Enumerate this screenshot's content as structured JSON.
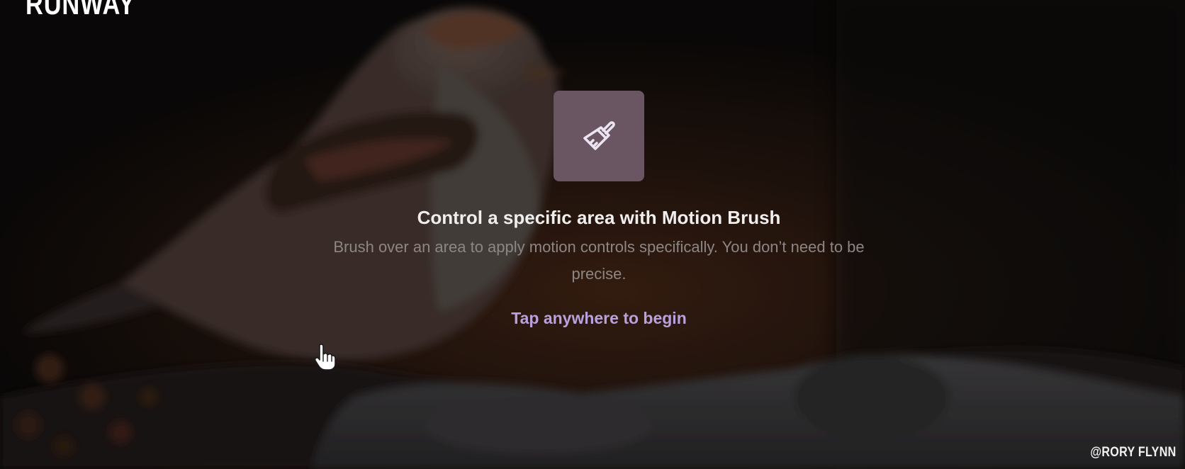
{
  "branding": {
    "logo_text": "RUNWAY",
    "credit": "@RORY FLYNN"
  },
  "onboarding": {
    "icon": "motion-brush-icon",
    "title": "Control a specific area with Motion Brush",
    "description": "Brush over an area to apply motion controls specifically. You don’t need to be precise.",
    "cta": "Tap anywhere to begin"
  },
  "colors": {
    "accent": "#b9a2dc",
    "icon_tile": "#6a5563",
    "title": "#f1eeee",
    "body": "#8c8684"
  }
}
